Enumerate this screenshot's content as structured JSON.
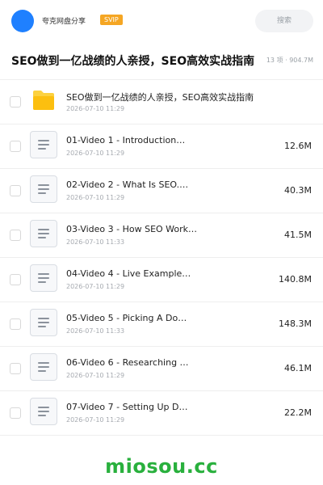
{
  "header": {
    "brand_name": "夸克网盘分享",
    "svip_label": "SVIP",
    "search_label": "搜索",
    "avatar_color": "#1f80ff",
    "svip_color": "#f5a623"
  },
  "share": {
    "title": "SEO做到一亿战绩的人亲授，SEO高效实战指南",
    "meta": "13 项 · 904.7M"
  },
  "files": [
    {
      "type": "folder",
      "icon": "folder-icon",
      "name": "SEO做到一亿战绩的人亲授，SEO高效实战指南",
      "date": "2026-07-10 11:29",
      "size": ""
    },
    {
      "type": "video",
      "icon": "file-doc-icon",
      "name": "01-Video 1 - Introduction…",
      "date": "2026-07-10 11:29",
      "size": "12.6M"
    },
    {
      "type": "video",
      "icon": "file-doc-icon",
      "name": "02-Video 2 - What Is SEO.…",
      "date": "2026-07-10 11:29",
      "size": "40.3M"
    },
    {
      "type": "video",
      "icon": "file-doc-icon",
      "name": "03-Video 3 - How SEO Work…",
      "date": "2026-07-10 11:33",
      "size": "41.5M"
    },
    {
      "type": "video",
      "icon": "file-doc-icon",
      "name": "04-Video 4 - Live Example…",
      "date": "2026-07-10 11:29",
      "size": "140.8M"
    },
    {
      "type": "video",
      "icon": "file-doc-icon",
      "name": "05-Video 5 - Picking A Do…",
      "date": "2026-07-10 11:33",
      "size": "148.3M"
    },
    {
      "type": "video",
      "icon": "file-doc-icon",
      "name": "06-Video 6 - Researching …",
      "date": "2026-07-10 11:29",
      "size": "46.1M"
    },
    {
      "type": "video",
      "icon": "file-doc-icon",
      "name": "07-Video 7 - Setting Up D…",
      "date": "2026-07-10 11:29",
      "size": "22.2M"
    }
  ],
  "watermark": {
    "text": "miosou.cc",
    "color": "#29b03d"
  }
}
